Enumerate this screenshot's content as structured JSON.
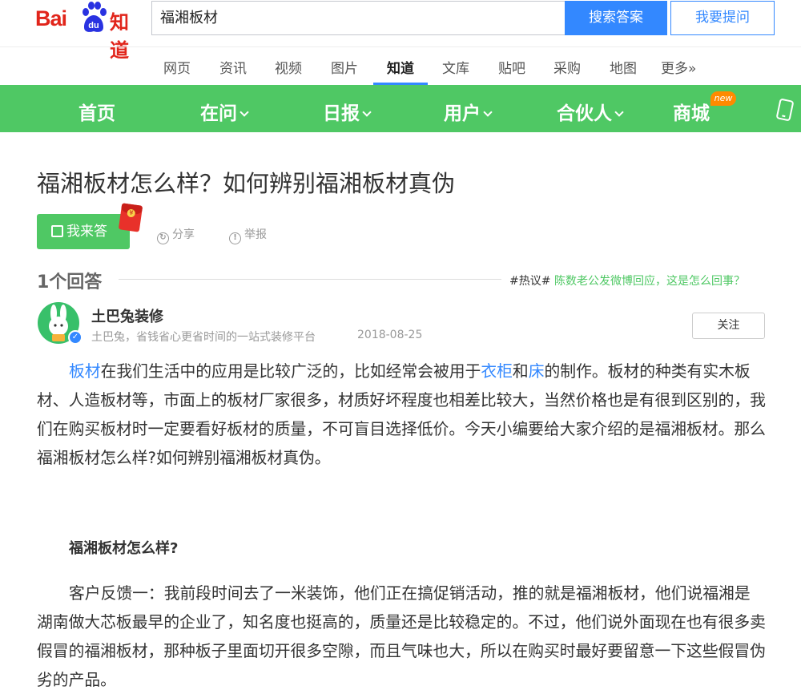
{
  "brand": {
    "logo_left": "Bai",
    "logo_paw_text": "du",
    "logo_right": "知道"
  },
  "search": {
    "query": "福湘板材",
    "search_button": "搜索答案",
    "ask_button": "我要提问"
  },
  "channels": [
    {
      "label": "网页"
    },
    {
      "label": "资讯"
    },
    {
      "label": "视频"
    },
    {
      "label": "图片"
    },
    {
      "label": "知道",
      "active": true
    },
    {
      "label": "文库"
    },
    {
      "label": "贴吧"
    },
    {
      "label": "采购"
    },
    {
      "label": "地图"
    },
    {
      "label": "更多»"
    }
  ],
  "green_nav": {
    "items": [
      {
        "label": "首页"
      },
      {
        "label": "在问"
      },
      {
        "label": "日报"
      },
      {
        "label": "用户"
      },
      {
        "label": "合伙人"
      },
      {
        "label": "商城"
      }
    ],
    "new_badge": "new",
    "color": "#4fc864"
  },
  "question": {
    "title": "福湘板材怎么样？如何辨别福湘板材真伪",
    "answer_button": "我来答",
    "share": "分享",
    "report": "举报"
  },
  "answers": {
    "count_label": "1个回答",
    "hot_tag": "#热议#",
    "hot_link": "陈数老公发微博回应，这是怎么回事？"
  },
  "author": {
    "name": "土巴兔装修",
    "desc": "土巴兔，省钱省心更省时间的一站式装修平台",
    "date": "2018-08-25",
    "follow": "关注"
  },
  "content": {
    "p1_link1": "板材",
    "p1_seg1": "在我们生活中的应用是比较广泛的，比如经常会被用于",
    "p1_link2": "衣柜",
    "p1_seg2": "和",
    "p1_link3": "床",
    "p1_seg3": "的制作。板材的种类有实木板材、人造板材等，市面上的板材厂家很多，材质好坏程度也相差比较大，当然价格也是有很到区别的，我们在购买板材时一定要看好板材的质量，不可盲目选择低价。今天小编要给大家介绍的是福湘板材。那么福湘板材怎么样?如何辨别福湘板材真伪。",
    "subhead": "福湘板材怎么样?",
    "p2": "客户反馈一：我前段时间去了一米装饰，他们正在搞促销活动，推的就是福湘板材，他们说福湘是湖南做大芯板最早的企业了，知名度也挺高的，质量还是比较稳定的。不过，他们说外面现在也有很多卖假冒的福湘板材，那种板子里面切开很多空隙，而且气味也大，所以在购买时最好要留意一下这些假冒伪劣的产品。"
  }
}
